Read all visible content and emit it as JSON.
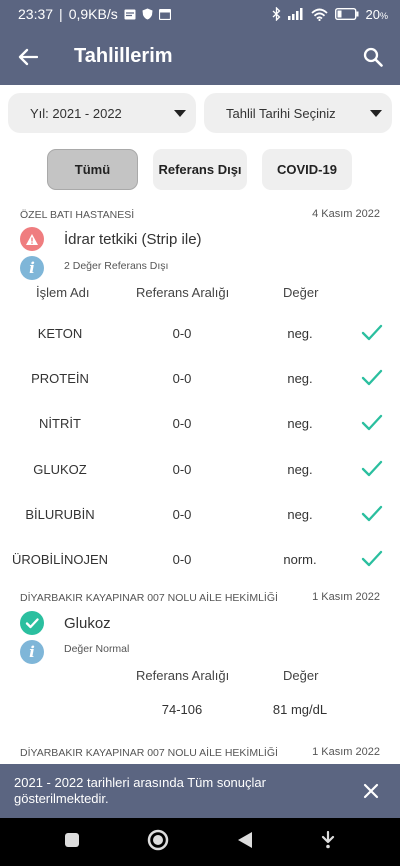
{
  "status": {
    "time": "23:37",
    "speed": "0,9KB/s",
    "battery": "20"
  },
  "appbar": {
    "title": "Tahlillerim"
  },
  "filters": {
    "year": "Yıl: 2021 - 2022",
    "date": "Tahlil Tarihi Seçiniz"
  },
  "tabs": [
    "Tümü",
    "Referans Dışı",
    "COVID-19"
  ],
  "results": [
    {
      "hospital": "ÖZEL BATI HASTANESİ",
      "date": "4 Kasım 2022",
      "test": "İdrar tetkiki (Strip ile)",
      "status": "warning",
      "note": "2 Değer Referans Dışı",
      "headers": {
        "name": "İşlem Adı",
        "ref": "Referans Aralığı",
        "value": "Değer"
      },
      "rows": [
        {
          "name": "KETON",
          "ref": "0-0",
          "value": "neg."
        },
        {
          "name": "PROTEİN",
          "ref": "0-0",
          "value": "neg."
        },
        {
          "name": "NİTRİT",
          "ref": "0-0",
          "value": "neg."
        },
        {
          "name": "GLUKOZ",
          "ref": "0-0",
          "value": "neg."
        },
        {
          "name": "BİLURUBİN",
          "ref": "0-0",
          "value": "neg."
        },
        {
          "name": "ÜROBİLİNOJEN",
          "ref": "0-0",
          "value": "norm."
        }
      ]
    },
    {
      "hospital": "DİYARBAKIR KAYAPINAR 007 NOLU AİLE HEKİMLİĞİ",
      "date": "1 Kasım 2022",
      "test": "Glukoz",
      "status": "normal",
      "note": "Değer Normal",
      "headers": {
        "ref": "Referans Aralığı",
        "value": "Değer"
      },
      "ref": "74-106",
      "value": "81 mg/dL"
    },
    {
      "hospital": "DİYARBAKIR KAYAPINAR 007 NOLU AİLE HEKİMLİĞİ",
      "date": "1 Kasım 2022"
    }
  ],
  "snackbar": {
    "message": "2021 - 2022 tarihleri arasında Tüm sonuçlar gösterilmektedir."
  },
  "colors": {
    "primary": "#5b6581",
    "warning": "#ef7d7f",
    "info": "#7fb6d8",
    "success": "#2bbf9f"
  },
  "icons": {
    "back": "arrow-left-icon",
    "search": "search-icon",
    "warning": "warning-icon",
    "info": "info-icon",
    "check": "check-icon",
    "close": "close-icon"
  }
}
